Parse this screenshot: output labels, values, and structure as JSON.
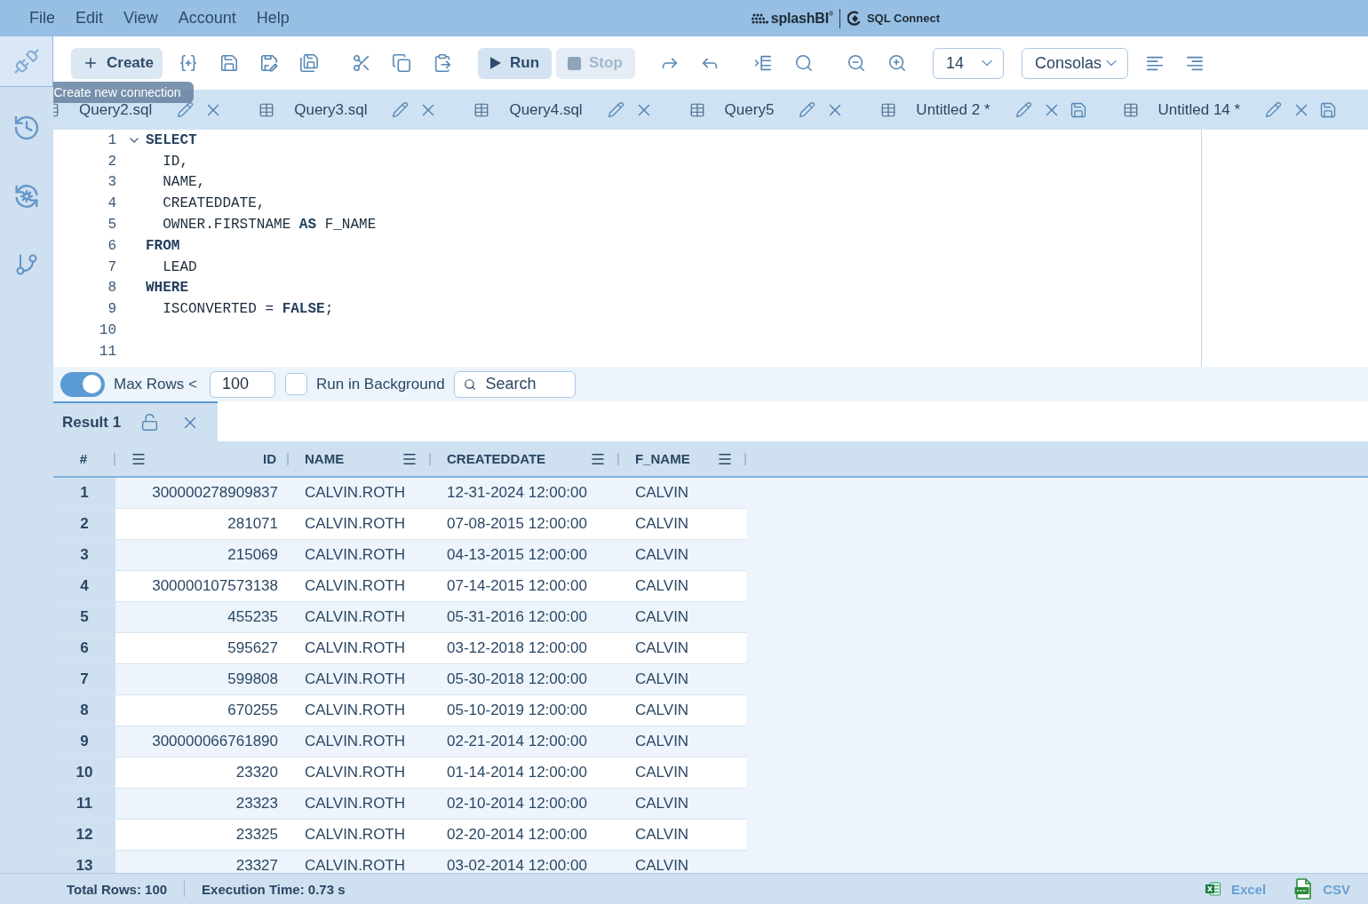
{
  "menu_bar": {
    "items": [
      "File",
      "Edit",
      "View",
      "Account",
      "Help"
    ],
    "brand": {
      "name": "splashBI$^{®}$",
      "product": "SQL Connect"
    }
  },
  "sidebar": {
    "items": [
      {
        "kind": "connections",
        "selected": true
      },
      {
        "kind": "history",
        "selected": false
      },
      {
        "kind": "sync",
        "selected": false
      },
      {
        "kind": "git",
        "selected": false
      }
    ]
  },
  "toolbar": {
    "create_button": "Create",
    "tooltip": "Create new connection",
    "run_button": {
      "label": "Run",
      "disabled": false
    },
    "stop_button": {
      "label": "Stop",
      "disabled": true
    },
    "font_size": "14",
    "font_family": "Consolas"
  },
  "tabs": [
    {
      "label": "Query2.sql",
      "modified": false
    },
    {
      "label": "Query3.sql",
      "modified": false
    },
    {
      "label": "Query4.sql",
      "modified": false
    },
    {
      "label": "Query5",
      "modified": false
    },
    {
      "label": "Untitled 2 *",
      "modified": true
    },
    {
      "label": "Untitled 14 *",
      "modified": true
    }
  ],
  "editor": {
    "lines": [
      {
        "number": "1",
        "text": "SELECT",
        "keyword": true,
        "indented": false,
        "foldable": true
      },
      {
        "number": "2",
        "text": "ID,",
        "keyword": false,
        "indented": true,
        "foldable": false
      },
      {
        "number": "3",
        "text": "NAME,",
        "keyword": false,
        "indented": true,
        "foldable": false
      },
      {
        "number": "4",
        "text": "CREATEDDATE,",
        "keyword": false,
        "indented": true,
        "foldable": false
      },
      {
        "number": "5",
        "text": "OWNER.FIRSTNAME **AS** F_NAME",
        "keyword": false,
        "indented": true,
        "foldable": false
      },
      {
        "number": "6",
        "text": "FROM",
        "keyword": true,
        "indented": false,
        "foldable": false
      },
      {
        "number": "7",
        "text": "LEAD",
        "keyword": false,
        "indented": true,
        "foldable": false
      },
      {
        "number": "8",
        "text": "WHERE",
        "keyword": true,
        "indented": false,
        "foldable": false
      },
      {
        "number": "9",
        "text": "ISCONVERTED = **FALSE**;",
        "keyword": false,
        "indented": true,
        "foldable": false
      },
      {
        "number": "10",
        "foldable": false
      },
      {
        "number": "11",
        "foldable": false
      }
    ]
  },
  "options": {
    "max_rows": {
      "on": true,
      "label": "Max Rows <",
      "value": "100"
    },
    "run_in_background": {
      "checked": false,
      "label": "Run in Background"
    },
    "search": {
      "placeholder": "Search"
    }
  },
  "results": {
    "tabs": [
      {
        "label": "Result 1",
        "selected": true,
        "locked": false
      }
    ],
    "columns": [
      {
        "label": "#",
        "kind": "index"
      },
      {
        "label": "ID",
        "kind": "number"
      },
      {
        "label": "NAME",
        "kind": "text"
      },
      {
        "label": "CREATEDDATE",
        "kind": "text"
      },
      {
        "label": "F_NAME",
        "kind": "text"
      }
    ],
    "rows": [
      [
        "1",
        "300000278909837",
        "CALVIN.ROTH",
        "12-31-2024 12:00:00",
        "CALVIN"
      ],
      [
        "2",
        "281071",
        "CALVIN.ROTH",
        "07-08-2015 12:00:00",
        "CALVIN"
      ],
      [
        "3",
        "215069",
        "CALVIN.ROTH",
        "04-13-2015 12:00:00",
        "CALVIN"
      ],
      [
        "4",
        "300000107573138",
        "CALVIN.ROTH",
        "07-14-2015 12:00:00",
        "CALVIN"
      ],
      [
        "5",
        "455235",
        "CALVIN.ROTH",
        "05-31-2016 12:00:00",
        "CALVIN"
      ],
      [
        "6",
        "595627",
        "CALVIN.ROTH",
        "03-12-2018 12:00:00",
        "CALVIN"
      ],
      [
        "7",
        "599808",
        "CALVIN.ROTH",
        "05-30-2018 12:00:00",
        "CALVIN"
      ],
      [
        "8",
        "670255",
        "CALVIN.ROTH",
        "05-10-2019 12:00:00",
        "CALVIN"
      ],
      [
        "9",
        "300000066761890",
        "CALVIN.ROTH",
        "02-21-2014 12:00:00",
        "CALVIN"
      ],
      [
        "10",
        "23320",
        "CALVIN.ROTH",
        "01-14-2014 12:00:00",
        "CALVIN"
      ],
      [
        "11",
        "23323",
        "CALVIN.ROTH",
        "02-10-2014 12:00:00",
        "CALVIN"
      ],
      [
        "12",
        "23325",
        "CALVIN.ROTH",
        "02-20-2014 12:00:00",
        "CALVIN"
      ],
      [
        "13",
        "23327",
        "CALVIN.ROTH",
        "03-02-2014 12:00:00",
        "CALVIN"
      ]
    ]
  },
  "status_bar": {
    "total_rows": "Total Rows: 100",
    "execution_time": "Execution Time: 0.73 s",
    "exports": [
      {
        "kind": "excel",
        "label": "Excel"
      },
      {
        "kind": "csv",
        "label": "CSV"
      }
    ]
  }
}
